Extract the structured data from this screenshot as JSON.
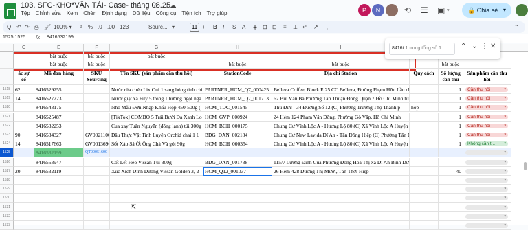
{
  "doc": {
    "title": "103. SFC-KHO*VẬN TẢI- Case- tháng 08.25"
  },
  "menu": [
    "Tệp",
    "Chỉnh sửa",
    "Xem",
    "Chèn",
    "Định dạng",
    "Dữ liệu",
    "Công cụ",
    "Tiện ích",
    "Trợ giúp"
  ],
  "top_right": {
    "avatars": [
      {
        "letter": "P",
        "color": "#c2185b"
      },
      {
        "letter": "N",
        "color": "#5c6bc0"
      }
    ],
    "share_label": "Chia sẻ"
  },
  "toolbar": {
    "search_menus": "Q",
    "font_name": "Sourc...",
    "font_size": "11",
    "bold": "B",
    "italic": "I",
    "strike": "S",
    "text_color": "A"
  },
  "formula_bar": {
    "namebox": "1525:1525",
    "fx": "fx",
    "value": "8416532199"
  },
  "find": {
    "query": "8416t",
    "count": "1 trong tổng số 1"
  },
  "columns": [
    "C",
    "E",
    "F",
    "G",
    "H",
    "I",
    "",
    "J",
    "K"
  ],
  "header_rows": {
    "row1": [
      "",
      "bắt buộc",
      "bắt buộc",
      "bắt buộc",
      "",
      "",
      "",
      "bắt buộc",
      ""
    ],
    "row2": [
      "",
      "bắt buộc",
      "bắt buộc",
      "",
      "bắt buộc",
      "bắt buộc",
      "",
      "bắt buộc",
      ""
    ],
    "row3": [
      "ác sự cố",
      "Mã đơn hàng",
      "SKU Sourcing",
      "Tên SKU (sản phẩm cần thu hồi)",
      "StationCode",
      "Địa chỉ Station",
      "Quy cách",
      "Số lượng cần thu",
      "Sản phẩm cần thu hồi"
    ]
  },
  "rows": [
    {
      "num": "1518",
      "c": "62",
      "e": "8416529255",
      "f": "",
      "g": "Nước rửa chén Lix Oni 1 sang bóng tinh chi",
      "h": "PARTNER_HCM_Q7_000425",
      "i": "Belleza Coffee, Block E 25 CC Belleza, Đường Phạm Hữu Lầu chai",
      "j": "",
      "k": "1",
      "dd": "Cần thu hồi",
      "dd_type": "red"
    },
    {
      "num": "1519",
      "c": "14",
      "e": "8416527223",
      "f": "",
      "g": "Nước giặt xả Fily 5 trong 1 hương ngọt ngà",
      "h": "PARTNER_HCM_Q7_001713",
      "i": "62 Bùi Văn Ba Phường Tân Thuận Đông Quận 7 Hồ Chí Minh túi",
      "j": "",
      "k": "1",
      "dd": "Cần thu hồi",
      "dd_type": "red"
    },
    {
      "num": "1520",
      "c": "",
      "e": "8416543175",
      "f": "",
      "g": "Nho Mẫu Đơn Nhập Khẩu Hộp 450-500g (",
      "h": "HCM_TDC_001545",
      "i": "Thủ Đức - 34 Đường Số 12 (C) Phường Trường Thọ Thành p",
      "j": "hộp",
      "k": "1",
      "dd": "Cần thu hồi",
      "dd_type": "red"
    },
    {
      "num": "1521",
      "c": "",
      "e": "8416525487",
      "f": "",
      "g": "[TikTok] COMBO 5 Trái Bưởi Da Xanh Lo",
      "h": "HCM_GVP_000924",
      "i": "24 Hẻm 124 Phạm Văn Đồng, Phường Gò Vấp, Hồ Chí Minh",
      "j": "",
      "k": "1",
      "dd": "Cần thu hồi",
      "dd_type": "red"
    },
    {
      "num": "1522",
      "c": "",
      "e": "8416532253",
      "f": "",
      "g": "Cua xay Tuấn Nguyễn (đông lạnh) túi 300g",
      "h": "HCM_BCH_000175",
      "i": "Chung Cư Vĩnh Lộc A - Hương Lộ 80 (C) Xã Vĩnh Lộc A Huyện Bình Chánh",
      "j": "",
      "k": "1",
      "dd": "Cần thu hồi",
      "dd_type": "red"
    },
    {
      "num": "1523",
      "c": "90",
      "e": "8416534327",
      "f": "GV0021100",
      "g": "Dầu Thực Vật Tinh Luyện Orchid chai 1 L",
      "h": "BDG_DAN_002184",
      "i": "Chung Cư New Lavida Dĩ An - Tân Đông Hiệp (C) Phường Tân Đông Hiệp T",
      "j": "",
      "k": "1",
      "dd": "Cần thu hồi",
      "dd_type": "red"
    },
    {
      "num": "1524",
      "c": "14",
      "e": "8416517663",
      "f": "GV0013690",
      "g": "Sốt Xào Sả Ớt Ông Chà Và gói 90g",
      "h": "HCM_BCH_000354",
      "i": "Chung Cư Vĩnh Lộc A - Hương Lộ 80 (C) Xã Vĩnh Lộc A Huyện Bình",
      "j": "",
      "k": "1",
      "dd": "Không cần t...",
      "dd_type": "green"
    },
    {
      "num": "1525",
      "c": "",
      "e": "8416532199",
      "f": "QT00051600",
      "g": "",
      "h": "",
      "i": "",
      "j": "",
      "k": "",
      "dd": "",
      "dd_type": "empty"
    },
    {
      "num": "1526",
      "c": "",
      "e": "8416553947",
      "f": "",
      "g": "Cốt Lết Heo Vissan Túi 300g",
      "h": "BDG_DAN_001738",
      "i": "115/7 Lương Đình Của Phường Đông Hòa Thị xã Dĩ An Bình Dương",
      "j": "",
      "k": "",
      "dd": "",
      "dd_type": "empty"
    },
    {
      "num": "1527",
      "c": "20",
      "e": "8416532119",
      "f": "",
      "g": "Xúc Xích Dinh Dưỡng Vissan Golden 3, 2",
      "h": "HCM_Q12_001037",
      "i": "26 Hẻm 428 Dương Thị Mười, Tân Thới Hiệp",
      "j": "",
      "k": "40",
      "dd": "",
      "dd_type": "empty"
    },
    {
      "num": "1528",
      "c": "",
      "e": "",
      "f": "",
      "g": "",
      "h": "",
      "i": "",
      "j": "",
      "k": "",
      "dd": "",
      "dd_type": "empty"
    },
    {
      "num": "1529",
      "c": "",
      "e": "",
      "f": "",
      "g": "",
      "h": "",
      "i": "",
      "j": "",
      "k": "",
      "dd": "",
      "dd_type": "empty"
    },
    {
      "num": "1530",
      "c": "",
      "e": "",
      "f": "",
      "g": "",
      "h": "",
      "i": "",
      "j": "",
      "k": "",
      "dd": "",
      "dd_type": "empty"
    },
    {
      "num": "1531",
      "c": "",
      "e": "",
      "f": "",
      "g": "",
      "h": "",
      "i": "",
      "j": "",
      "k": "",
      "dd": "",
      "dd_type": "empty"
    },
    {
      "num": "1532",
      "c": "",
      "e": "",
      "f": "",
      "g": "",
      "h": "",
      "i": "",
      "j": "",
      "k": "",
      "dd": "",
      "dd_type": "empty"
    },
    {
      "num": "1533",
      "c": "",
      "e": "",
      "f": "",
      "g": "",
      "h": "",
      "i": "",
      "j": "",
      "k": "",
      "dd": "",
      "dd_type": "empty"
    }
  ],
  "colors": {
    "red_chip_bg": "#f8d7d7",
    "red_chip_text": "#b3261e",
    "green_chip_bg": "#d4edda",
    "green_chip_text": "#1e7e34",
    "empty_chip_bg": "#e8e8e8",
    "highlight_green": "#6ccb8a",
    "selection_outline": "#d93025"
  }
}
